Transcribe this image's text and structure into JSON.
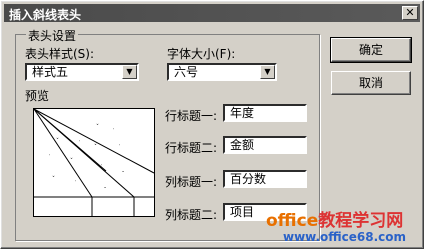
{
  "window": {
    "title": "插入斜线表头"
  },
  "group": {
    "legend": "表头设置"
  },
  "header_style": {
    "label": "表头样式(S):",
    "value": "样式五"
  },
  "font_size": {
    "label": "字体大小(F):",
    "value": "六号"
  },
  "preview": {
    "label": "预览"
  },
  "fields": [
    {
      "label": "行标题一:",
      "value": "年度"
    },
    {
      "label": "行标题二:",
      "value": "金额"
    },
    {
      "label": "列标题一:",
      "value": "百分数"
    },
    {
      "label": "列标题二:",
      "value": "项目"
    }
  ],
  "buttons": {
    "ok": "确定",
    "cancel": "取消"
  },
  "watermark": {
    "line1_a": "office",
    "line1_b": "教程学习网",
    "line2": "www.office68.com"
  },
  "icons": {
    "close": "close-icon",
    "dropdown": "chevron-down-icon"
  }
}
